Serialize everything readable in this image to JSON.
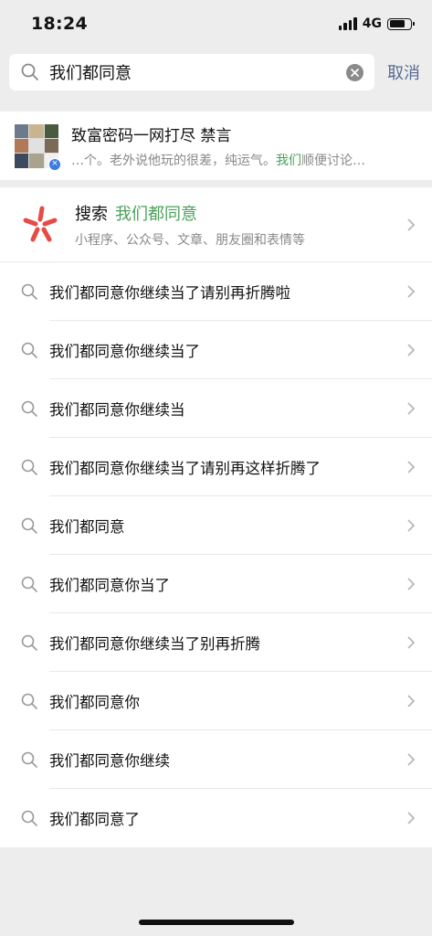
{
  "status": {
    "time": "18:24",
    "network": "4G"
  },
  "search": {
    "query": "我们都同意",
    "cancel_label": "取消"
  },
  "result_card": {
    "title": "致富密码一网打尽 禁言",
    "sub_prefix": "…个。老外说他玩的很差，纯运气。",
    "sub_highlight": "我们",
    "sub_suffix": "顺便讨论…"
  },
  "search_entry": {
    "label": "搜索",
    "keyword": "我们都同意",
    "subtitle": "小程序、公众号、文章、朋友圈和表情等"
  },
  "suggestions": [
    "我们都同意你继续当了请别再折腾啦",
    "我们都同意你继续当了",
    "我们都同意你继续当",
    "我们都同意你继续当了请别再这样折腾了",
    "我们都同意",
    "我们都同意你当了",
    "我们都同意你继续当了别再折腾",
    "我们都同意你",
    "我们都同意你继续",
    "我们都同意了"
  ],
  "colors": {
    "accent_green": "#4aa15a",
    "link_blue": "#576b95",
    "star_red": "#e64b46"
  }
}
